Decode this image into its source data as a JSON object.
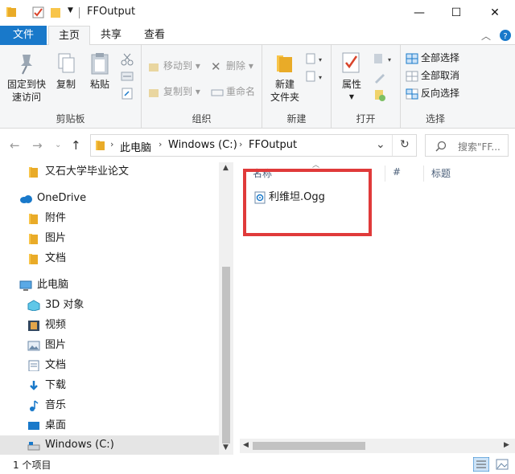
{
  "window": {
    "title": "FFOutput",
    "controls": {
      "minimize": "—",
      "maximize": "☐",
      "close": "✕"
    }
  },
  "ribbon": {
    "tabs": {
      "file": "文件",
      "home": "主页",
      "share": "共享",
      "view": "查看"
    },
    "clipboard": {
      "pin_label_1": "固定到快",
      "pin_label_2": "速访问",
      "copy_label": "复制",
      "paste_label": "粘贴",
      "group_label": "剪贴板"
    },
    "organize": {
      "move_to": "移动到",
      "copy_to": "复制到",
      "delete": "删除",
      "rename": "重命名",
      "group_label": "组织"
    },
    "new": {
      "new_folder_1": "新建",
      "new_folder_2": "文件夹",
      "group_label": "新建"
    },
    "open": {
      "properties": "属性",
      "group_label": "打开"
    },
    "select": {
      "select_all": "全部选择",
      "select_none": "全部取消",
      "invert": "反向选择",
      "group_label": "选择"
    }
  },
  "address": {
    "crumbs": [
      "此电脑",
      "Windows (C:)",
      "FFOutput"
    ],
    "search_placeholder": "搜索\"FF..."
  },
  "navpane": {
    "items": [
      {
        "label": "又石大学毕业论文",
        "icon": "folder-icon"
      },
      {
        "label": "OneDrive",
        "icon": "cloud-icon"
      },
      {
        "label": "附件",
        "icon": "folder-icon"
      },
      {
        "label": "图片",
        "icon": "folder-icon"
      },
      {
        "label": "文档",
        "icon": "folder-icon"
      },
      {
        "label": "此电脑",
        "icon": "computer-icon"
      },
      {
        "label": "3D 对象",
        "icon": "3d-objects-icon"
      },
      {
        "label": "视频",
        "icon": "video-icon"
      },
      {
        "label": "图片",
        "icon": "pictures-icon"
      },
      {
        "label": "文档",
        "icon": "documents-icon"
      },
      {
        "label": "下载",
        "icon": "download-icon"
      },
      {
        "label": "音乐",
        "icon": "music-icon"
      },
      {
        "label": "桌面",
        "icon": "desktop-icon"
      },
      {
        "label": "Windows (C:)",
        "icon": "drive-icon"
      }
    ]
  },
  "filepane": {
    "columns": {
      "name": "名称",
      "number": "#",
      "title": "标题"
    },
    "files": [
      {
        "name": "利维坦.Ogg",
        "icon": "audio-file-icon"
      }
    ]
  },
  "status": {
    "item_count": "1 个项目"
  },
  "colors": {
    "accent": "#1979ca",
    "highlight_box": "#e03a3a",
    "folder": "#f8c54a"
  }
}
